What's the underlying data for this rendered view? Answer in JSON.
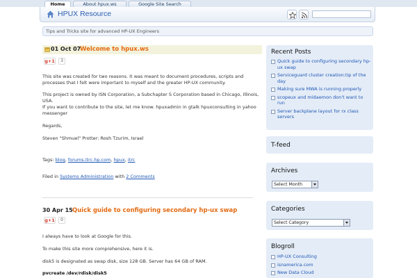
{
  "tabs": [
    "Home",
    "About hpux.ws",
    "Google Site Search"
  ],
  "header": {
    "title": "HPUX Resource"
  },
  "tagline": "Tips and Tricks site for advanced HP-UX Engineers",
  "post1": {
    "date": "01 Oct 07",
    "title": "Welcome to hpux.ws",
    "gplus": "g+1",
    "count": "3",
    "para1": "This site was created for two reasons. It was meant to document procedures, scripts and processes that I felt were important to myself and the greater HP-UX community.",
    "para2": "This project is owned by ISN Corporation, a Subchapter S Corporation based in Chicago, Illinois, USA.",
    "para3": "If you want to contribute to the site, let me know. hpuxadmin in gtalk hpuxconsulting in yahoo messenger",
    "para4": "Regards,",
    "para5": "Steven \"Shmuel\" Protter: Rosh Tzurim, Israel",
    "tags_label": "Tags:",
    "tags": [
      "blog",
      "forums.itrc.hp.com",
      "hpux",
      "itrc"
    ],
    "filed_label": "Filed in",
    "category": "Systems Administration",
    "with": "with",
    "comments": "2 Comments"
  },
  "post2": {
    "date": "30 Apr 15",
    "title": "Quick guide to configuring secondary hp-ux swap",
    "gplus": "g+1",
    "count": "0",
    "para1": "I always have to look at Google for this.",
    "para2": "To make this site more comprehensive, here it is.",
    "para3": "disk5 is designated as swap disk, size 128 GB. Server has 64 GB of RAM.",
    "code": "pvcreate /dev/rdisk/disk5"
  },
  "sidebar": {
    "recent_title": "Recent Posts",
    "recent": [
      "Quick guide to configuring secondary hp-ux swap",
      "Serviceguard cluster creation:tip of the day",
      "Making sure MWA is running properly",
      "scopeux and midaemon don't want to run",
      "Server backplane layout for rx class servers"
    ],
    "tfeed_title": "T-feed",
    "archives_title": "Archives",
    "archives_select": "Select Month",
    "categories_title": "Categories",
    "categories_select": "Select Category",
    "blogroll_title": "Blogroll",
    "blogroll": [
      "HP-UX Consulting",
      "isnamerica.com",
      "New Data Cloud"
    ]
  },
  "colors": {
    "accent": "#e36b12",
    "link": "#1e57b5",
    "sidebar_bg": "#e4ecf7"
  },
  "icons": [
    "home-icon",
    "star-icon",
    "rss-icon"
  ]
}
